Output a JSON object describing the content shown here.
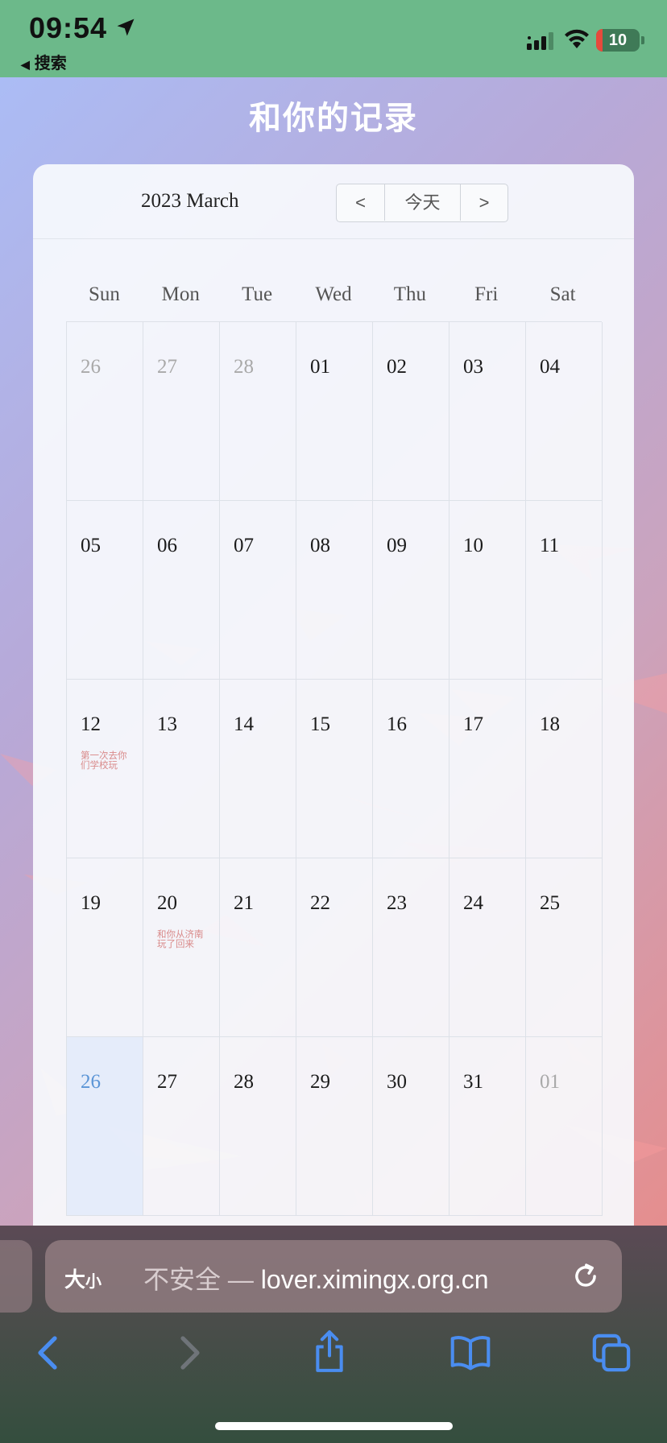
{
  "status_bar": {
    "time": "09:54",
    "back_app": "搜索",
    "battery": "10",
    "icons": [
      "location-arrow-icon",
      "signal-icon",
      "wifi-icon",
      "battery-icon"
    ]
  },
  "page": {
    "title": "和你的记录"
  },
  "calendar": {
    "month_label": "2023 March",
    "nav": {
      "prev": "<",
      "today": "今天",
      "next": ">"
    },
    "weekdays": [
      "Sun",
      "Mon",
      "Tue",
      "Wed",
      "Thu",
      "Fri",
      "Sat"
    ],
    "weeks": [
      [
        {
          "day": "26",
          "other_month": true
        },
        {
          "day": "27",
          "other_month": true
        },
        {
          "day": "28",
          "other_month": true
        },
        {
          "day": "01"
        },
        {
          "day": "02"
        },
        {
          "day": "03"
        },
        {
          "day": "04"
        }
      ],
      [
        {
          "day": "05"
        },
        {
          "day": "06"
        },
        {
          "day": "07"
        },
        {
          "day": "08"
        },
        {
          "day": "09"
        },
        {
          "day": "10"
        },
        {
          "day": "11"
        }
      ],
      [
        {
          "day": "12",
          "event": "第一次去你们学校玩"
        },
        {
          "day": "13"
        },
        {
          "day": "14"
        },
        {
          "day": "15"
        },
        {
          "day": "16"
        },
        {
          "day": "17"
        },
        {
          "day": "18"
        }
      ],
      [
        {
          "day": "19"
        },
        {
          "day": "20",
          "event": "和你从济南玩了回来"
        },
        {
          "day": "21"
        },
        {
          "day": "22"
        },
        {
          "day": "23"
        },
        {
          "day": "24"
        },
        {
          "day": "25"
        }
      ],
      [
        {
          "day": "26",
          "today": true
        },
        {
          "day": "27"
        },
        {
          "day": "28"
        },
        {
          "day": "29"
        },
        {
          "day": "30"
        },
        {
          "day": "31"
        },
        {
          "day": "01",
          "other_month": true
        }
      ]
    ],
    "colors": {
      "today_number": "#5b95d6",
      "event_text": "#d98a8a",
      "other_month": "#a9a9a9"
    }
  },
  "browser": {
    "text_size_label_big": "大",
    "text_size_label_small": "小",
    "url_insecure": "不安全 — ",
    "url_domain": "lover.ximingx.org.cn",
    "toolbar_icons": [
      "back-icon",
      "forward-icon",
      "share-icon",
      "bookmarks-icon",
      "tabs-icon"
    ]
  }
}
